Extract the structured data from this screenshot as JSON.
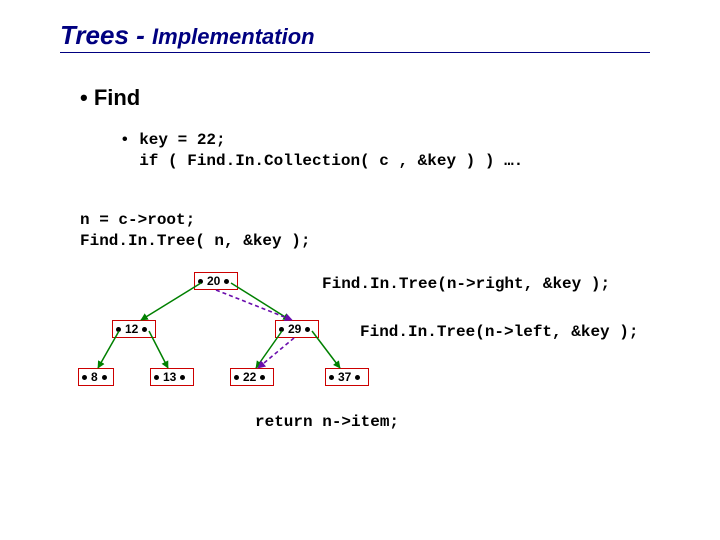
{
  "title_main": "Trees",
  "title_sep": " - ",
  "title_sub": "Implementation",
  "bullet_main": "• Find",
  "code_line1": "• key = 22;",
  "code_line2": "  if ( Find.In.Collection( c , &key ) ) ….",
  "snippet2_line1": "n = c->root;",
  "snippet2_line2": "Find.In.Tree( n, &key );",
  "call_right": "Find.In.Tree(n->right, &key );",
  "call_left": "Find.In.Tree(n->left, &key );",
  "return_line": "return n->item;",
  "tree": {
    "root": "20",
    "l": "12",
    "r": "29",
    "ll": "8",
    "lr": "13",
    "rl": "22",
    "rr": "37"
  }
}
